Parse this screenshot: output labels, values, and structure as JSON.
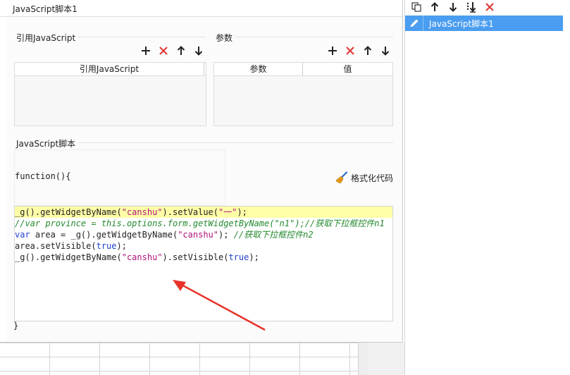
{
  "dialog": {
    "title": "JavaScript脚本1",
    "ref_section": {
      "title": "引用JavaScript",
      "column": "引用JavaScript"
    },
    "param_section": {
      "title": "参数",
      "columns": [
        "参数",
        "值"
      ]
    },
    "script_section": {
      "title": "JavaScript脚本",
      "function_open": "function(){",
      "function_close": "}",
      "format_button": "格式化代码"
    }
  },
  "editor": {
    "lines": [
      [
        {
          "t": "_g().getWidgetByName(",
          "c": "p"
        },
        {
          "t": "\"canshu\"",
          "c": "s"
        },
        {
          "t": ").setValue(",
          "c": "p"
        },
        {
          "t": "\"一\"",
          "c": "s"
        },
        {
          "t": ");",
          "c": "p"
        }
      ],
      [
        {
          "t": "//var province = this.options.form.getWidgetByName(\"n1\");//获取下拉框控件n1",
          "c": "c"
        }
      ],
      [
        {
          "t": "var",
          "c": "k"
        },
        {
          "t": " area = _g().getWidgetByName(",
          "c": "p"
        },
        {
          "t": "\"canshu\"",
          "c": "s"
        },
        {
          "t": "); ",
          "c": "p"
        },
        {
          "t": "//获取下拉框控件n2",
          "c": "c"
        }
      ],
      [
        {
          "t": "area.setVisible(",
          "c": "p"
        },
        {
          "t": "true",
          "c": "k"
        },
        {
          "t": ");",
          "c": "p"
        }
      ],
      [
        {
          "t": "_g().getWidgetByName(",
          "c": "p"
        },
        {
          "t": "\"canshu\"",
          "c": "s"
        },
        {
          "t": ").setVisible(",
          "c": "p"
        },
        {
          "t": "true",
          "c": "k"
        },
        {
          "t": ");",
          "c": "p"
        }
      ]
    ]
  },
  "right_panel": {
    "items": [
      {
        "label": "JavaScript脚本1"
      }
    ]
  },
  "colors": {
    "accent_blue": "#4a9df0",
    "delete_red": "#e23b3b",
    "current_line": "#ffffa8",
    "annotation_arrow": "#e8332a"
  }
}
